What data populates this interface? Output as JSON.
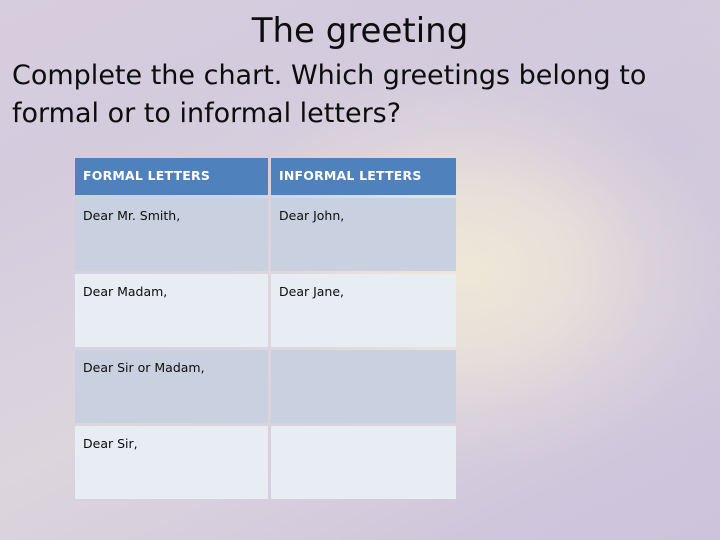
{
  "slide": {
    "title": "The greeting",
    "instructions": "Complete the chart. Which greetings belong to formal or to informal letters?",
    "accent_color": "#4F81BD",
    "row_dark_color": "#C9D1E0",
    "row_light_color": "#E8ECF3",
    "background_colors": [
      "#D6CDDF",
      "#EFE9DC",
      "#CDC3DA"
    ]
  },
  "table": {
    "headers": [
      "FORMAL LETTERS",
      "INFORMAL LETTERS"
    ],
    "rows": [
      {
        "formal": "Dear Mr. Smith,",
        "informal": "Dear John,"
      },
      {
        "formal": "Dear Madam,",
        "informal": "Dear Jane,"
      },
      {
        "formal": "Dear Sir or Madam,",
        "informal": ""
      },
      {
        "formal": "Dear Sir,",
        "informal": ""
      }
    ]
  }
}
